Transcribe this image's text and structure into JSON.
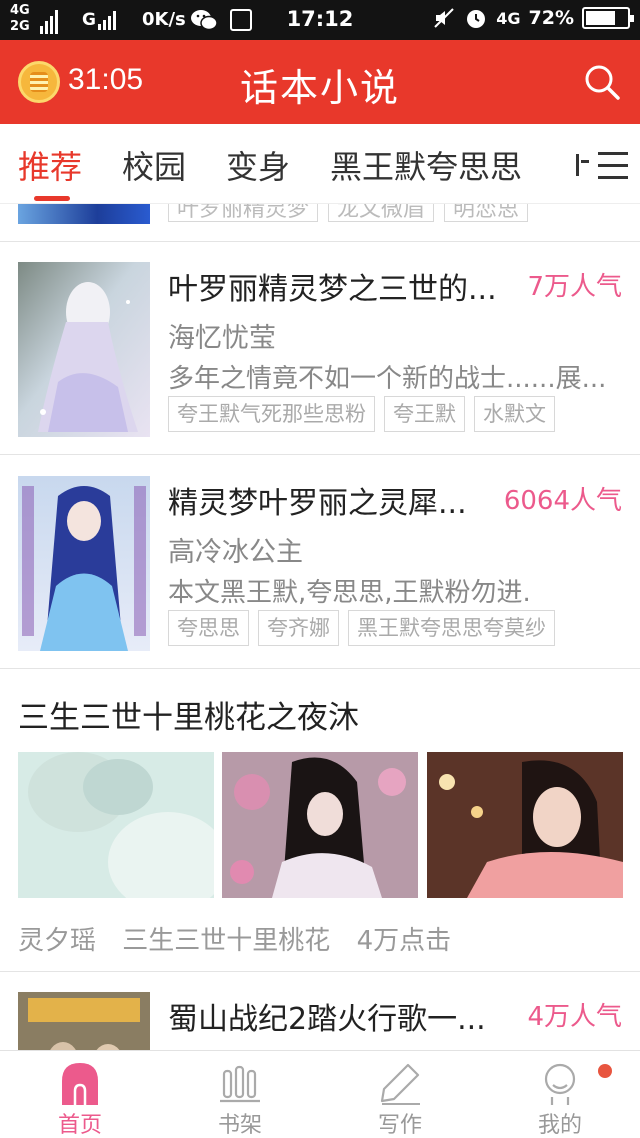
{
  "status_bar": {
    "network_top": "4G",
    "network_bottom": "2G",
    "network_g": "G",
    "speed": "0K/s",
    "time": "17:12",
    "network_right": "4G",
    "battery_percent": "72%",
    "battery_level": 0.72
  },
  "header": {
    "timer": "31:05",
    "title": "话本小说",
    "coin_icon": "gold-coin-icon",
    "search_icon": "search-icon"
  },
  "tabs": [
    {
      "label": "推荐",
      "active": true
    },
    {
      "label": "校园",
      "active": false
    },
    {
      "label": "变身",
      "active": false
    },
    {
      "label": "黑王默夸思思",
      "active": false
    }
  ],
  "tabs_more_icon": "category-menu-icon",
  "feed": {
    "partial_tags": [
      "叶罗丽精灵梦",
      "龙文微眉",
      "明恋思"
    ],
    "books": [
      {
        "title": "叶罗丽精灵梦之三世的...",
        "popularity": "7万人气",
        "author": "海忆忧莹",
        "description": "多年之情竟不如一个新的战士......展...",
        "tags": [
          "夸王默气死那些思粉",
          "夸王默",
          "水默文"
        ]
      },
      {
        "title": "精灵梦叶罗丽之灵犀...",
        "popularity": "6064人气",
        "author": "高冷冰公主",
        "description": "本文黑王默,夸思思,王默粉勿进.",
        "tags": [
          "夸思思",
          "夸齐娜",
          "黑王默夸思思夸莫纱"
        ]
      }
    ],
    "featured": {
      "title": "三生三世十里桃花之夜沐",
      "author": "灵夕瑶",
      "category": "三生三世十里桃花",
      "clicks": "4万点击"
    },
    "last_book": {
      "title": "蜀山战纪2踏火行歌一...",
      "popularity": "4万人气"
    }
  },
  "bottom_nav": [
    {
      "label": "首页",
      "icon": "home-icon",
      "active": true
    },
    {
      "label": "书架",
      "icon": "bookshelf-icon",
      "active": false
    },
    {
      "label": "写作",
      "icon": "pencil-icon",
      "active": false
    },
    {
      "label": "我的",
      "icon": "profile-icon",
      "active": false
    }
  ],
  "colors": {
    "brand_red": "#e8382b",
    "popularity_pink": "#ec5a8c",
    "status_bar": "#131313"
  }
}
